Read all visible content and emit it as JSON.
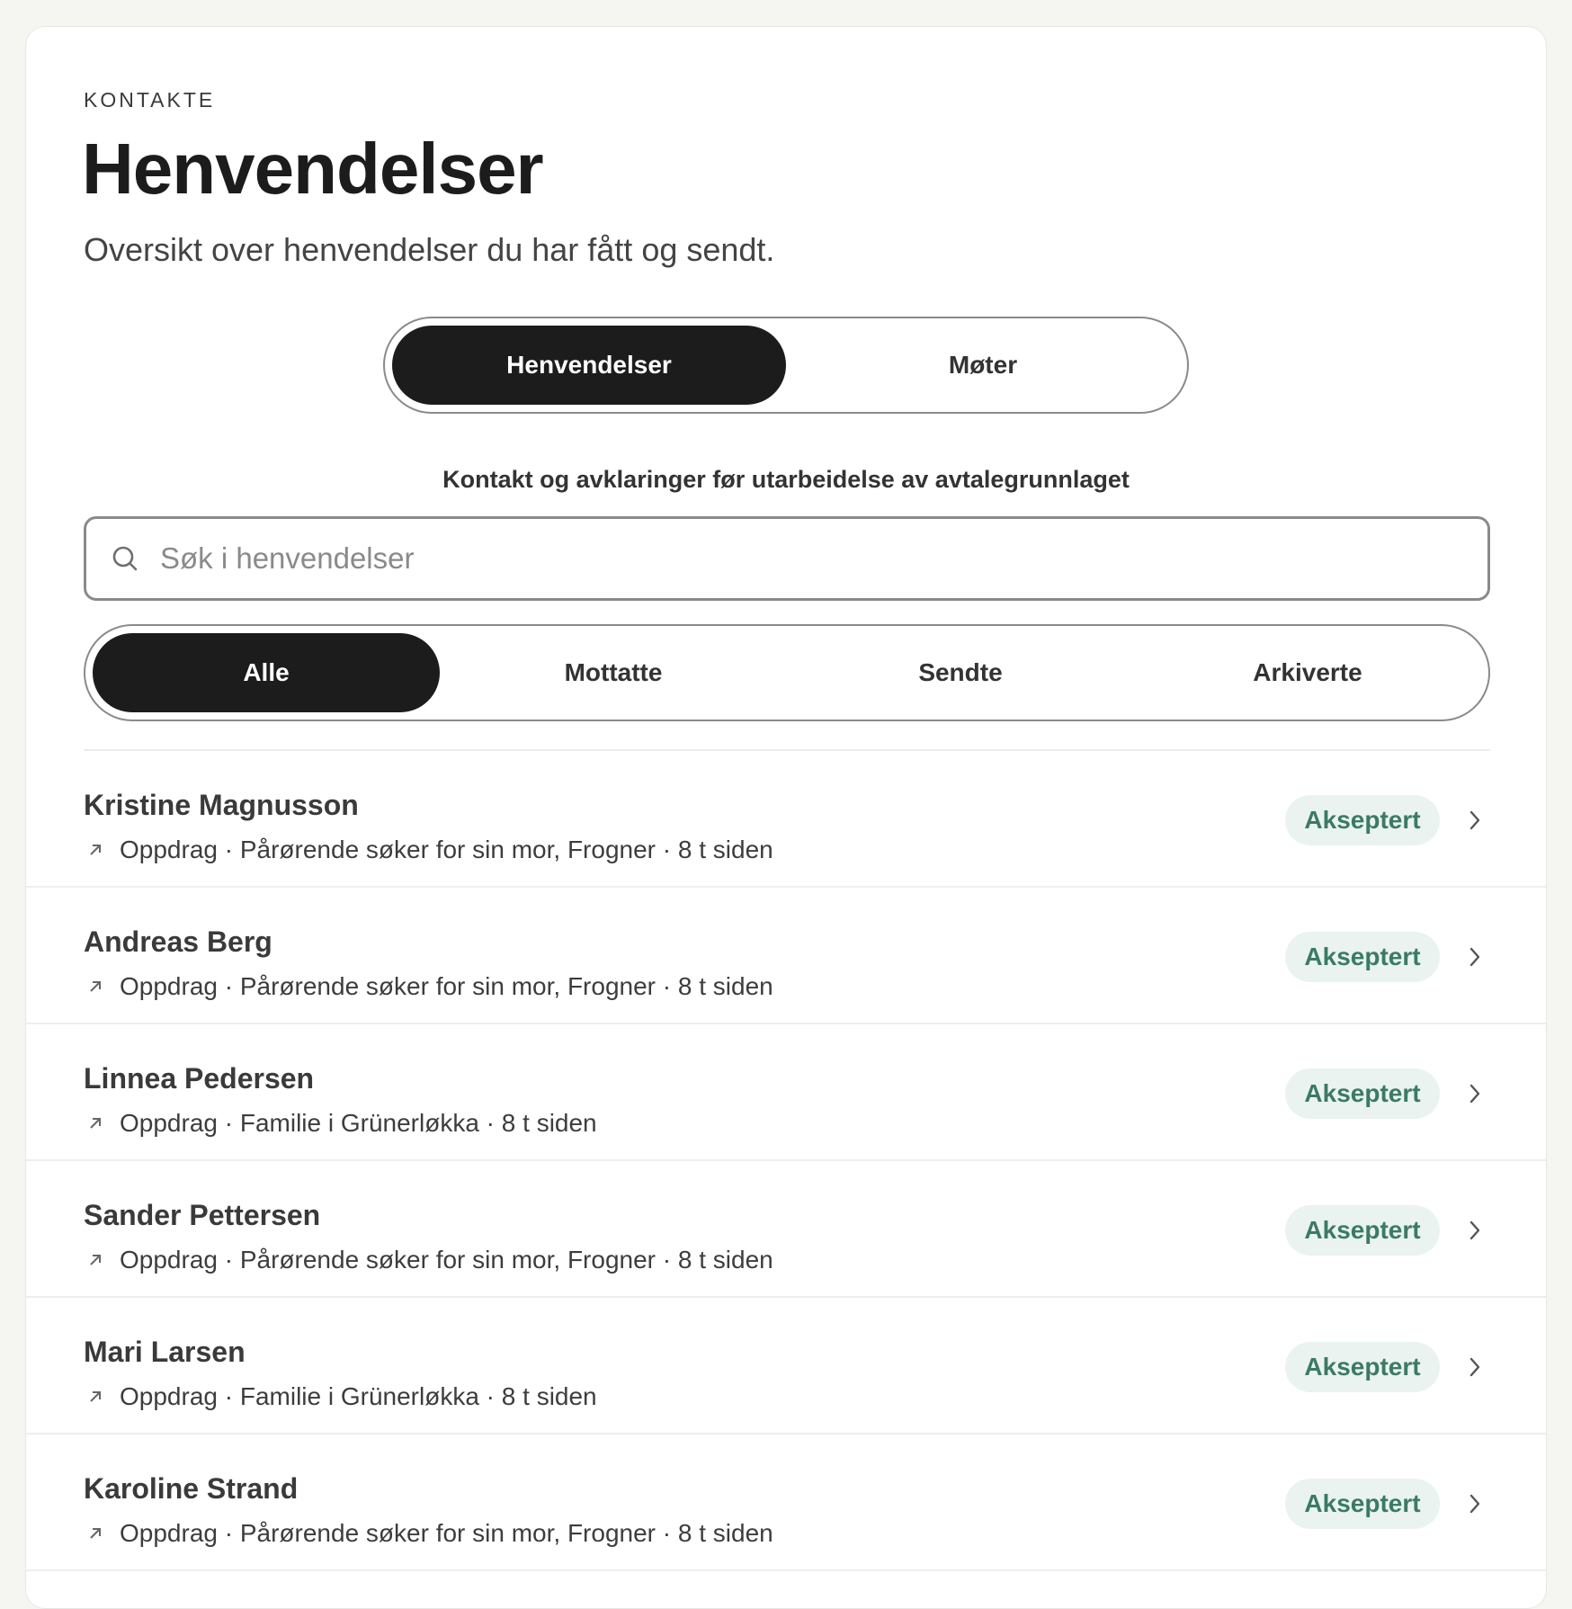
{
  "header": {
    "eyebrow": "KONTAKTE",
    "title": "Henvendelser",
    "subtitle": "Oversikt over henvendelser du har fått og sendt."
  },
  "view_toggle": {
    "options": [
      "Henvendelser",
      "Møter"
    ],
    "selected": "Henvendelser",
    "description": "Kontakt og avklaringer før utarbeidelse av avtalegrunnlaget"
  },
  "search": {
    "placeholder": "Søk i henvendelser",
    "value": ""
  },
  "filters": {
    "options": [
      "Alle",
      "Mottatte",
      "Sendte",
      "Arkiverte"
    ],
    "selected": "Alle"
  },
  "status_color": "#3b7a66",
  "status_bg": "#eaf3f0",
  "items": [
    {
      "name": "Kristine Magnusson",
      "meta": "Oppdrag · Pårørende søker for sin mor, Frogner · 8 t siden",
      "status": "Akseptert"
    },
    {
      "name": "Andreas Berg",
      "meta": "Oppdrag · Pårørende søker for sin mor, Frogner · 8 t siden",
      "status": "Akseptert"
    },
    {
      "name": "Linnea Pedersen",
      "meta": "Oppdrag · Familie i Grünerløkka · 8 t siden",
      "status": "Akseptert"
    },
    {
      "name": "Sander Pettersen",
      "meta": "Oppdrag · Pårørende søker for sin mor, Frogner · 8 t siden",
      "status": "Akseptert"
    },
    {
      "name": "Mari Larsen",
      "meta": "Oppdrag · Familie i Grünerløkka · 8 t siden",
      "status": "Akseptert"
    },
    {
      "name": "Karoline Strand",
      "meta": "Oppdrag · Pårørende søker for sin mor, Frogner · 8 t siden",
      "status": "Akseptert"
    }
  ]
}
